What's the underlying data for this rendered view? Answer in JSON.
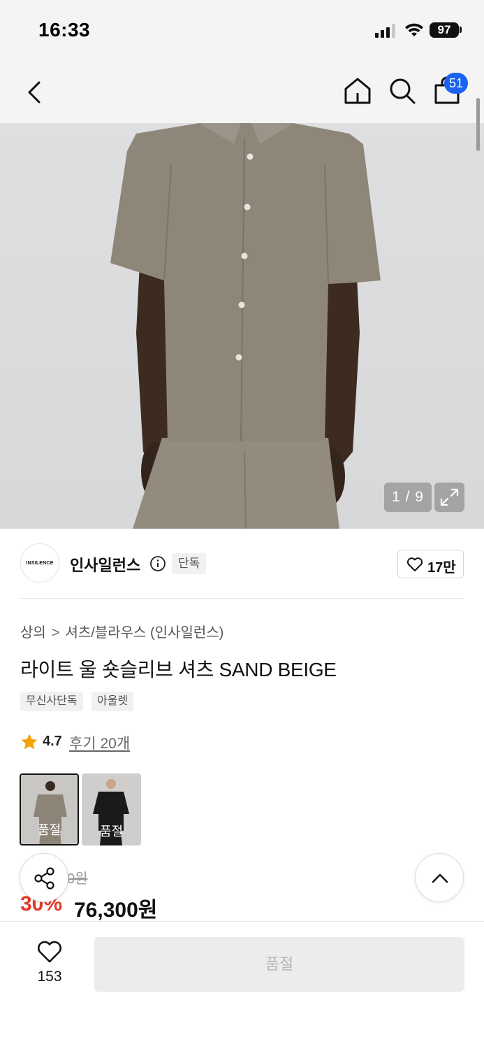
{
  "status_bar": {
    "time": "16:33",
    "battery": "97"
  },
  "nav": {
    "cart_count": "51"
  },
  "gallery": {
    "counter": "1 / 9"
  },
  "brand": {
    "name": "인사일런스",
    "logo_text": "INSILENCE",
    "exclusive_label": "단독",
    "likes": "17만"
  },
  "breadcrumb": {
    "category": "상의",
    "separator": ">",
    "subcategory": "셔츠/블라우스 (인사일런스)"
  },
  "product": {
    "title": "라이트 울 숏슬리브 셔츠 SAND BEIGE",
    "tags": [
      "무신사단독",
      "아울렛"
    ],
    "rating": "4.7",
    "review_link": "후기 20개"
  },
  "options": [
    {
      "label": "품절",
      "color": "#8d8478",
      "selected": true
    },
    {
      "label": "품절",
      "color": "#1a1a1a",
      "selected": false
    }
  ],
  "price": {
    "original": "0원",
    "discount": "30%",
    "sale": "76,300원"
  },
  "bottom": {
    "wish_count": "153",
    "buy_label": "품절"
  },
  "colors": {
    "accent": "#1a62f0",
    "discount": "#e23a2a",
    "star": "#f5a200"
  }
}
